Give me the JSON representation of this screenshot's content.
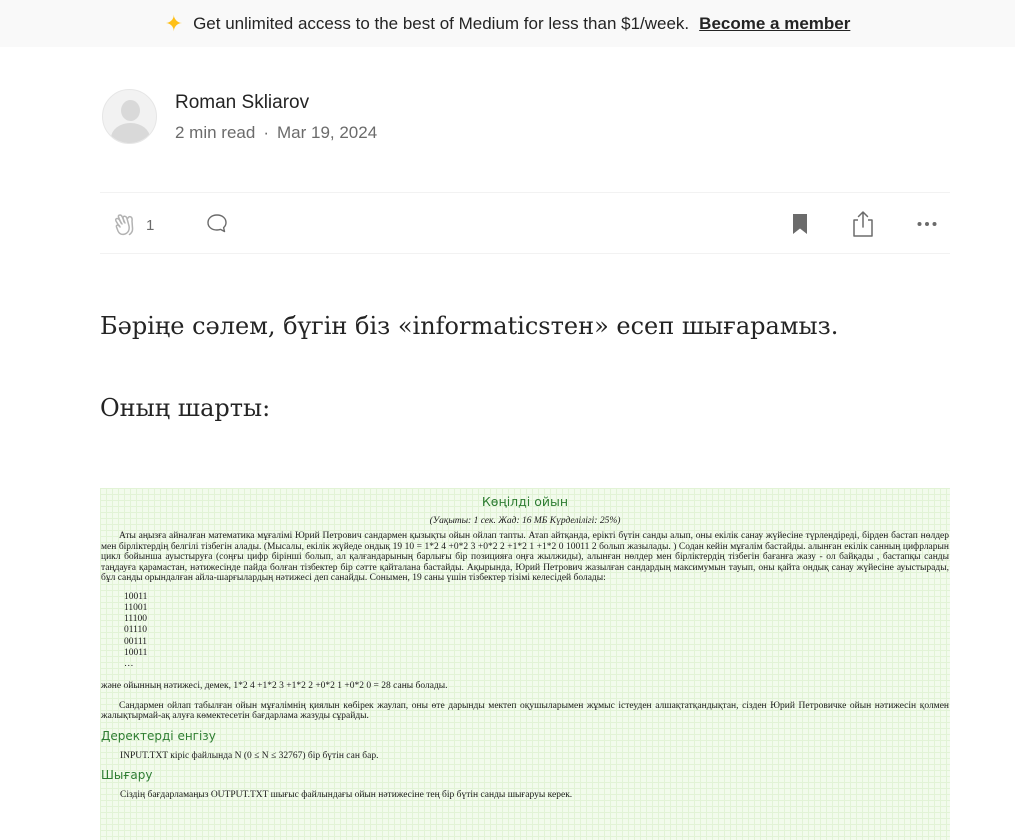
{
  "banner": {
    "text": "Get unlimited access to the best of Medium for less than $1/week.",
    "link": "Become a member"
  },
  "author": {
    "name": "Roman Skliarov",
    "read_time": "2 min read",
    "separator": "·",
    "date": "Mar 19, 2024"
  },
  "actions": {
    "clap_count": "1"
  },
  "article": {
    "p1": "Бәріңе сәлем, бүгін біз «informaticsтен» есеп шығарамыз.",
    "p2": "Оның шарты:"
  },
  "problem": {
    "title": "Көңілді ойын",
    "constraints": "(Уақыты: 1 сек. Жад: 16 МБ Күрделілігі: 25%)",
    "para1": "Аты аңызға айналған математика мұғалімі Юрий Петрович сандармен қызықты ойын ойлап тапты. Атап айтқанда, ерікті бүтін санды алып, оны екілік санау жүйесіне түрлендіреді, бірден бастап нөлдер мен бірліктердің белгілі тізбегін алады. (Мысалы, екілік жүйеде ондық 19 10 = 1*2 4 +0*2 3 +0*2 2 +1*2 1 +1*2 0 10011 2 болып жазылады. ) Содан кейін мұғалім бастайды. алынған екілік санның цифрларын цикл бойынша ауыстыруға (соңғы цифр бірінші болып, ал қалғандарының барлығы бір позицияға оңға жылжиды), алынған нөлдер мен бірліктердің тізбегін бағанға жазу - ол байқады , бастапқы санды таңдауға қарамастан, нәтижесінде пайда болған тізбектер бір сәтте қайталана бастайды. Ақырында, Юрий Петрович жазылған сандардың максимумын тауып, оны қайта ондық санау жүйесіне ауыстырады, бұл санды орындалған айла-шарғылардың нәтижесі деп санайды. Сонымен, 19 саны үшін тізбектер тізімі келесідей болады:",
    "binary_list": [
      "10011",
      "11001",
      "11100",
      "01110",
      "00111",
      "10011",
      "…"
    ],
    "result_line": "және ойынның нәтижесі, демек, 1*2 4 +1*2 3 +1*2 2 +0*2 1 +0*2 0 = 28 саны болады.",
    "para2": "Сандармен ойлап табылған ойын мұғалімнің қиялын көбірек жаулап, оны өте дарынды мектеп оқушыларымен жұмыс істеуден алшақтатқандықтан, сізден Юрий Петровичке ойын нәтижесін қолмен жалықтырмай-ақ алуға көмектесетін бағдарлама жазуды сұрайды.",
    "input_title": "Деректерді енгізу",
    "input_text": "INPUT.TXT кіріс файлында N (0 ≤ N ≤ 32767) бір бүтін сан бар.",
    "output_title": "Шығару",
    "output_text": "Сіздің бағдарламаңыз OUTPUT.TXT шығыс файлындағы ойын нәтижесіне тең бір бүтін санды шығаруы керек."
  },
  "colors": {
    "banner_bg": "#f9f9f9",
    "star": "#ffc017",
    "problem_heading": "#2e7d32",
    "problem_bg": "#f2fbec"
  },
  "icons": [
    "sparkle-icon",
    "clap-icon",
    "comment-icon",
    "bookmark-icon",
    "share-icon",
    "more-icon"
  ]
}
